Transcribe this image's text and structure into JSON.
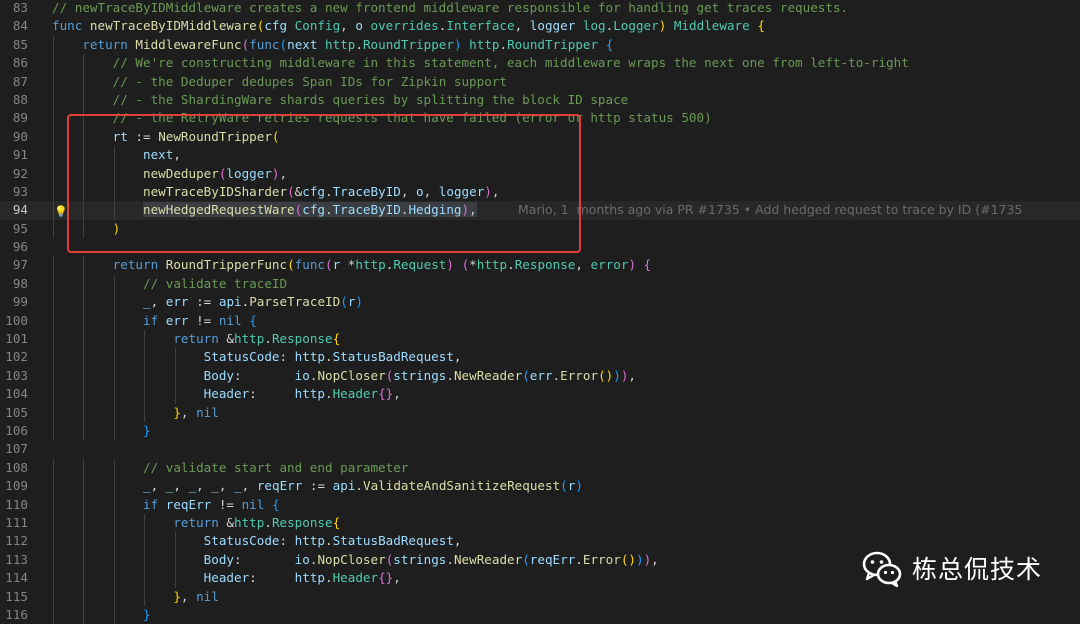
{
  "editor": {
    "lines": [
      {
        "num": "83",
        "tokens": [
          [
            "c",
            "// newTraceByIDMiddleware creates a new frontend middleware responsible for handling get traces requests."
          ]
        ]
      },
      {
        "num": "84",
        "tokens": [
          [
            "k",
            "func "
          ],
          [
            "f",
            "newTraceByIDMiddleware"
          ],
          [
            "b1",
            "("
          ],
          [
            "v",
            "cfg "
          ],
          [
            "t",
            "Config"
          ],
          [
            "p",
            ", "
          ],
          [
            "v",
            "o "
          ],
          [
            "t",
            "overrides"
          ],
          [
            "p",
            "."
          ],
          [
            "t",
            "Interface"
          ],
          [
            "p",
            ", "
          ],
          [
            "v",
            "logger "
          ],
          [
            "t",
            "log"
          ],
          [
            "p",
            "."
          ],
          [
            "t",
            "Logger"
          ],
          [
            "b1",
            ")"
          ],
          [
            "p",
            " "
          ],
          [
            "t",
            "Middleware"
          ],
          [
            "p",
            " "
          ],
          [
            "b1",
            "{"
          ]
        ]
      },
      {
        "num": "85",
        "tokens": [
          [
            "p",
            "    "
          ],
          [
            "k",
            "return "
          ],
          [
            "f",
            "MiddlewareFunc"
          ],
          [
            "b2",
            "("
          ],
          [
            "k",
            "func"
          ],
          [
            "b3",
            "("
          ],
          [
            "v",
            "next "
          ],
          [
            "t",
            "http"
          ],
          [
            "p",
            "."
          ],
          [
            "t",
            "RoundTripper"
          ],
          [
            "b3",
            ")"
          ],
          [
            "p",
            " "
          ],
          [
            "t",
            "http"
          ],
          [
            "p",
            "."
          ],
          [
            "t",
            "RoundTripper"
          ],
          [
            "p",
            " "
          ],
          [
            "b3",
            "{"
          ]
        ]
      },
      {
        "num": "86",
        "tokens": [
          [
            "p",
            "        "
          ],
          [
            "c",
            "// We're constructing middleware in this statement, each middleware wraps the next one from left-to-right"
          ]
        ]
      },
      {
        "num": "87",
        "tokens": [
          [
            "p",
            "        "
          ],
          [
            "c",
            "// - the Deduper dedupes Span IDs for Zipkin support"
          ]
        ]
      },
      {
        "num": "88",
        "tokens": [
          [
            "p",
            "        "
          ],
          [
            "c",
            "// - the ShardingWare shards queries by splitting the block ID space"
          ]
        ]
      },
      {
        "num": "89",
        "tokens": [
          [
            "p",
            "        "
          ],
          [
            "c",
            "// - the RetryWare retries requests that have failed (error or http status 500)"
          ]
        ]
      },
      {
        "num": "90",
        "tokens": [
          [
            "p",
            "        "
          ],
          [
            "v",
            "rt"
          ],
          [
            "p",
            " := "
          ],
          [
            "f",
            "NewRoundTripper"
          ],
          [
            "b1",
            "("
          ]
        ]
      },
      {
        "num": "91",
        "tokens": [
          [
            "p",
            "            "
          ],
          [
            "v",
            "next"
          ],
          [
            "p",
            ","
          ]
        ]
      },
      {
        "num": "92",
        "tokens": [
          [
            "p",
            "            "
          ],
          [
            "f",
            "newDeduper"
          ],
          [
            "b2",
            "("
          ],
          [
            "v",
            "logger"
          ],
          [
            "b2",
            ")"
          ],
          [
            "p",
            ","
          ]
        ]
      },
      {
        "num": "93",
        "tokens": [
          [
            "p",
            "            "
          ],
          [
            "f",
            "newTraceByIDSharder"
          ],
          [
            "b2",
            "("
          ],
          [
            "p",
            "&"
          ],
          [
            "v",
            "cfg"
          ],
          [
            "p",
            "."
          ],
          [
            "v",
            "TraceByID"
          ],
          [
            "p",
            ", "
          ],
          [
            "v",
            "o"
          ],
          [
            "p",
            ", "
          ],
          [
            "v",
            "logger"
          ],
          [
            "b2",
            ")"
          ],
          [
            "p",
            ","
          ]
        ]
      },
      {
        "num": "94",
        "current": true,
        "tokens": [
          [
            "p",
            "            "
          ],
          [
            "f",
            "newHedgedRequestWare"
          ],
          [
            "b2",
            "("
          ],
          [
            "v",
            "cfg"
          ],
          [
            "p",
            "."
          ],
          [
            "v",
            "TraceByID"
          ],
          [
            "p",
            "."
          ],
          [
            "v",
            "Hedging"
          ],
          [
            "b2",
            ")"
          ],
          [
            "p",
            ","
          ]
        ],
        "blame": "Mario, 1  months ago via PR #1735 • Add hedged request to trace by ID (#1735"
      },
      {
        "num": "95",
        "tokens": [
          [
            "p",
            "        "
          ],
          [
            "b1",
            ")"
          ]
        ]
      },
      {
        "num": "96",
        "tokens": []
      },
      {
        "num": "97",
        "tokens": [
          [
            "p",
            "        "
          ],
          [
            "k",
            "return "
          ],
          [
            "f",
            "RoundTripperFunc"
          ],
          [
            "b1",
            "("
          ],
          [
            "k",
            "func"
          ],
          [
            "b2",
            "("
          ],
          [
            "v",
            "r "
          ],
          [
            "p",
            "*"
          ],
          [
            "t",
            "http"
          ],
          [
            "p",
            "."
          ],
          [
            "t",
            "Request"
          ],
          [
            "b2",
            ")"
          ],
          [
            "p",
            " "
          ],
          [
            "b2",
            "("
          ],
          [
            "p",
            "*"
          ],
          [
            "t",
            "http"
          ],
          [
            "p",
            "."
          ],
          [
            "t",
            "Response"
          ],
          [
            "p",
            ", "
          ],
          [
            "t",
            "error"
          ],
          [
            "b2",
            ")"
          ],
          [
            "p",
            " "
          ],
          [
            "b2",
            "{"
          ]
        ]
      },
      {
        "num": "98",
        "tokens": [
          [
            "p",
            "            "
          ],
          [
            "c",
            "// validate traceID"
          ]
        ]
      },
      {
        "num": "99",
        "tokens": [
          [
            "p",
            "            "
          ],
          [
            "v",
            "_"
          ],
          [
            "p",
            ", "
          ],
          [
            "v",
            "err"
          ],
          [
            "p",
            " := "
          ],
          [
            "v",
            "api"
          ],
          [
            "p",
            "."
          ],
          [
            "f",
            "ParseTraceID"
          ],
          [
            "b3",
            "("
          ],
          [
            "v",
            "r"
          ],
          [
            "b3",
            ")"
          ]
        ]
      },
      {
        "num": "100",
        "tokens": [
          [
            "p",
            "            "
          ],
          [
            "k",
            "if "
          ],
          [
            "v",
            "err"
          ],
          [
            "p",
            " != "
          ],
          [
            "k",
            "nil "
          ],
          [
            "b3",
            "{"
          ]
        ]
      },
      {
        "num": "101",
        "tokens": [
          [
            "p",
            "                "
          ],
          [
            "k",
            "return "
          ],
          [
            "p",
            "&"
          ],
          [
            "t",
            "http"
          ],
          [
            "p",
            "."
          ],
          [
            "t",
            "Response"
          ],
          [
            "b1",
            "{"
          ]
        ]
      },
      {
        "num": "102",
        "tokens": [
          [
            "p",
            "                    "
          ],
          [
            "v",
            "StatusCode"
          ],
          [
            "p",
            ": "
          ],
          [
            "v",
            "http"
          ],
          [
            "p",
            "."
          ],
          [
            "v",
            "StatusBadRequest"
          ],
          [
            "p",
            ","
          ]
        ]
      },
      {
        "num": "103",
        "tokens": [
          [
            "p",
            "                    "
          ],
          [
            "v",
            "Body"
          ],
          [
            "p",
            ":       "
          ],
          [
            "v",
            "io"
          ],
          [
            "p",
            "."
          ],
          [
            "f",
            "NopCloser"
          ],
          [
            "b2",
            "("
          ],
          [
            "v",
            "strings"
          ],
          [
            "p",
            "."
          ],
          [
            "f",
            "NewReader"
          ],
          [
            "b3",
            "("
          ],
          [
            "v",
            "err"
          ],
          [
            "p",
            "."
          ],
          [
            "f",
            "Error"
          ],
          [
            "b1",
            "()"
          ],
          [
            "b3",
            ")"
          ],
          [
            "b2",
            ")"
          ],
          [
            "p",
            ","
          ]
        ]
      },
      {
        "num": "104",
        "tokens": [
          [
            "p",
            "                    "
          ],
          [
            "v",
            "Header"
          ],
          [
            "p",
            ":     "
          ],
          [
            "v",
            "http"
          ],
          [
            "p",
            "."
          ],
          [
            "t",
            "Header"
          ],
          [
            "b2",
            "{}"
          ],
          [
            "p",
            ","
          ]
        ]
      },
      {
        "num": "105",
        "tokens": [
          [
            "p",
            "                "
          ],
          [
            "b1",
            "}"
          ],
          [
            "p",
            ", "
          ],
          [
            "k",
            "nil"
          ]
        ]
      },
      {
        "num": "106",
        "tokens": [
          [
            "p",
            "            "
          ],
          [
            "b3",
            "}"
          ]
        ]
      },
      {
        "num": "107",
        "tokens": []
      },
      {
        "num": "108",
        "tokens": [
          [
            "p",
            "            "
          ],
          [
            "c",
            "// validate start and end parameter"
          ]
        ]
      },
      {
        "num": "109",
        "tokens": [
          [
            "p",
            "            "
          ],
          [
            "v",
            "_"
          ],
          [
            "p",
            ", "
          ],
          [
            "v",
            "_"
          ],
          [
            "p",
            ", "
          ],
          [
            "v",
            "_"
          ],
          [
            "p",
            ", "
          ],
          [
            "v",
            "_"
          ],
          [
            "p",
            ", "
          ],
          [
            "v",
            "_"
          ],
          [
            "p",
            ", "
          ],
          [
            "v",
            "reqErr"
          ],
          [
            "p",
            " := "
          ],
          [
            "v",
            "api"
          ],
          [
            "p",
            "."
          ],
          [
            "f",
            "ValidateAndSanitizeRequest"
          ],
          [
            "b3",
            "("
          ],
          [
            "v",
            "r"
          ],
          [
            "b3",
            ")"
          ]
        ]
      },
      {
        "num": "110",
        "tokens": [
          [
            "p",
            "            "
          ],
          [
            "k",
            "if "
          ],
          [
            "v",
            "reqErr"
          ],
          [
            "p",
            " != "
          ],
          [
            "k",
            "nil "
          ],
          [
            "b3",
            "{"
          ]
        ]
      },
      {
        "num": "111",
        "tokens": [
          [
            "p",
            "                "
          ],
          [
            "k",
            "return "
          ],
          [
            "p",
            "&"
          ],
          [
            "t",
            "http"
          ],
          [
            "p",
            "."
          ],
          [
            "t",
            "Response"
          ],
          [
            "b1",
            "{"
          ]
        ]
      },
      {
        "num": "112",
        "tokens": [
          [
            "p",
            "                    "
          ],
          [
            "v",
            "StatusCode"
          ],
          [
            "p",
            ": "
          ],
          [
            "v",
            "http"
          ],
          [
            "p",
            "."
          ],
          [
            "v",
            "StatusBadRequest"
          ],
          [
            "p",
            ","
          ]
        ]
      },
      {
        "num": "113",
        "tokens": [
          [
            "p",
            "                    "
          ],
          [
            "v",
            "Body"
          ],
          [
            "p",
            ":       "
          ],
          [
            "v",
            "io"
          ],
          [
            "p",
            "."
          ],
          [
            "f",
            "NopCloser"
          ],
          [
            "b2",
            "("
          ],
          [
            "v",
            "strings"
          ],
          [
            "p",
            "."
          ],
          [
            "f",
            "NewReader"
          ],
          [
            "b3",
            "("
          ],
          [
            "v",
            "reqErr"
          ],
          [
            "p",
            "."
          ],
          [
            "f",
            "Error"
          ],
          [
            "b1",
            "()"
          ],
          [
            "b3",
            ")"
          ],
          [
            "b2",
            ")"
          ],
          [
            "p",
            ","
          ]
        ]
      },
      {
        "num": "114",
        "tokens": [
          [
            "p",
            "                    "
          ],
          [
            "v",
            "Header"
          ],
          [
            "p",
            ":     "
          ],
          [
            "v",
            "http"
          ],
          [
            "p",
            "."
          ],
          [
            "t",
            "Header"
          ],
          [
            "b2",
            "{}"
          ],
          [
            "p",
            ","
          ]
        ]
      },
      {
        "num": "115",
        "tokens": [
          [
            "p",
            "                "
          ],
          [
            "b1",
            "}"
          ],
          [
            "p",
            ", "
          ],
          [
            "k",
            "nil"
          ]
        ]
      },
      {
        "num": "116",
        "tokens": [
          [
            "p",
            "            "
          ],
          [
            "b3",
            "}"
          ]
        ]
      }
    ]
  },
  "watermark": {
    "text": "栋总侃技术",
    "icon": "wechat-icon"
  },
  "colors": {
    "background": "#1e1e1e",
    "highlight_box": "#e0403c"
  }
}
